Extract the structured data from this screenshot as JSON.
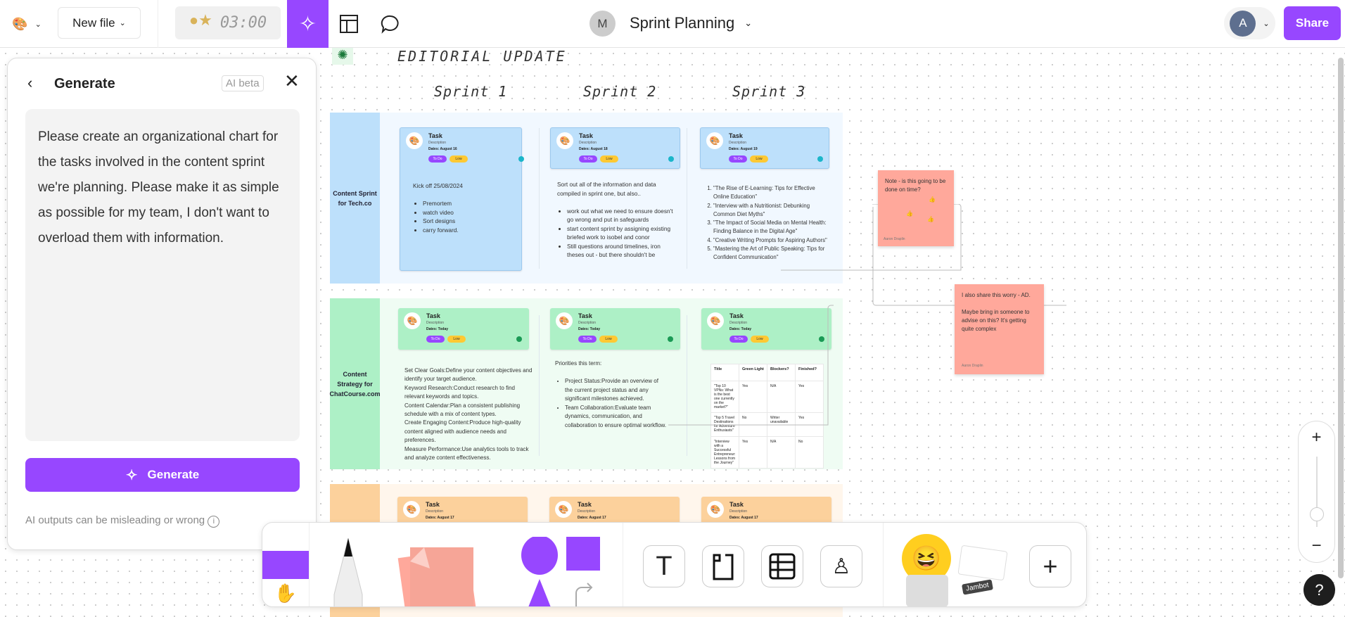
{
  "topbar": {
    "new_file": "New file",
    "timer": "03:00",
    "avatar_initial": "M",
    "board_title": "Sprint Planning",
    "user_initial": "A",
    "share": "Share"
  },
  "panel": {
    "title": "Generate",
    "badge": "AI beta",
    "prompt": "Please create an organizational chart for the tasks involved in the content sprint we're planning. Please make it as simple as possible for my team, I don't want to overload them with information.",
    "generate": "Generate",
    "disclaimer": "AI outputs can be misleading or wrong"
  },
  "board": {
    "title": "EDITORIAL UPDATE",
    "sprints": [
      "Sprint 1",
      "Sprint 2",
      "Sprint 3"
    ],
    "rows": [
      {
        "label": "Content Sprint for Tech.co",
        "color": "#bde0fb",
        "cards": [
          {
            "title": "Task",
            "desc": "Description",
            "date": "Dates: August 16",
            "status": "To Do",
            "priority": "Low"
          },
          {
            "title": "Task",
            "desc": "Description",
            "date": "Dates: August 18",
            "status": "To Do",
            "priority": "Low"
          },
          {
            "title": "Task",
            "desc": "Description",
            "date": "Dates: August 19",
            "status": "To Do",
            "priority": "Low"
          }
        ],
        "col1": {
          "heading": "Kick off 25/08/2024",
          "items": [
            "Premortem",
            "watch  video",
            "Sort designs",
            "carry forward."
          ]
        },
        "col2": {
          "heading": "Sort out all of the information and data compiled in sprint one, but also..",
          "items": [
            "work out what we need to ensure doesn't go wrong and put in safeguards",
            "start content sprint by assigning existing briefed work to isobel and conor",
            "Still questions around timelines, iron theses out - but there shouldn't be"
          ]
        },
        "col3": {
          "items": [
            "\"The Rise of E-Learning: Tips for Effective Online Education\"",
            "\"Interview with a Nutritionist: Debunking Common Diet Myths\"",
            "\"The Impact of Social Media on Mental Health: Finding Balance in the Digital Age\"",
            "\"Creative Writing Prompts for Aspiring Authors\"",
            "\"Mastering the Art of Public Speaking: Tips for Confident Communication\""
          ]
        }
      },
      {
        "label": "Content Strategy for ChatCourse.com",
        "color": "#adf0c6",
        "cards": [
          {
            "title": "Task",
            "desc": "Description",
            "date": "Dates: Today",
            "status": "To Do",
            "priority": "Low"
          },
          {
            "title": "Task",
            "desc": "Description",
            "date": "Dates: Today",
            "status": "To Do",
            "priority": "Low"
          },
          {
            "title": "Task",
            "desc": "Description",
            "date": "Dates: Today",
            "status": "To Do",
            "priority": "Low"
          }
        ],
        "col1": {
          "lines": [
            "Set Clear Goals:Define your content objectives and identify your target audience.",
            "Keyword Research:Conduct research to find relevant keywords and topics.",
            "Content Calendar:Plan a consistent publishing schedule with a mix of content types.",
            "Create Engaging Content:Produce high-quality content aligned with audience needs and preferences.",
            "Measure Performance:Use analytics tools to track and analyze content effectiveness."
          ]
        },
        "col2": {
          "heading": "Priorities this term:",
          "items": [
            "Project Status:Provide an overview of the current project status and any significant milestones achieved.",
            "Team Collaboration:Evaluate team dynamics, communication, and collaboration to ensure optimal workflow."
          ]
        },
        "table": {
          "headers": [
            "Title",
            "Green Light",
            "Blockers?",
            "Finished?"
          ],
          "rows": [
            [
              "\"Top 10 VPNs: What is the best one currently on the market?\"",
              "Yes",
              "N/A",
              "Yes"
            ],
            [
              "\"Top 5 Travel Destinations for Adventure Enthusiasts\"",
              "No",
              "Writer unavailable",
              "Yes"
            ],
            [
              "\"Interview with a Successful Entrepreneur: Lessons from the Journey\"",
              "Yes",
              "N/A",
              "No"
            ]
          ]
        }
      },
      {
        "label": "",
        "color": "#fcd19c",
        "cards": [
          {
            "title": "Task",
            "desc": "Description",
            "date": "Dates: August 17"
          },
          {
            "title": "Task",
            "desc": "Description",
            "date": "Dates: August 17"
          },
          {
            "title": "Task",
            "desc": "Description",
            "date": "Dates: August 17"
          }
        ]
      }
    ]
  },
  "stickies": [
    {
      "text": "Note - is this going to be done on time?",
      "author": "Aaron Draplin"
    },
    {
      "text": "I also share this worry - AD.",
      "text2": "Maybe bring in someone to advise on this? It's getting quite complex",
      "author": "Aaron Draplin"
    }
  ],
  "toolbar": {
    "stickers_label": "Jambot"
  },
  "zoom": {
    "in": "+",
    "out": "−"
  },
  "help": "?",
  "colors": {
    "accent": "#9747ff",
    "sticky": "#ffa89b"
  }
}
